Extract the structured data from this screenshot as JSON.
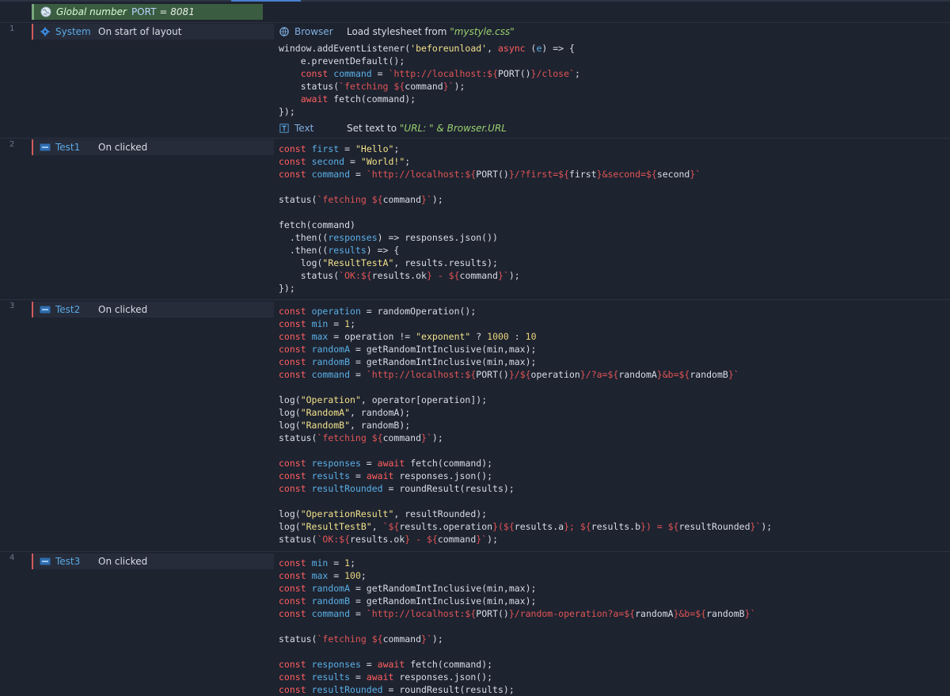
{
  "global": {
    "name": "Global number",
    "var": "PORT",
    "eq": "= 8081"
  },
  "events": [
    {
      "num": "1",
      "object": "System",
      "trigger": "On start of layout"
    },
    {
      "num": "2",
      "object": "Test1",
      "trigger": "On clicked"
    },
    {
      "num": "3",
      "object": "Test2",
      "trigger": "On clicked"
    },
    {
      "num": "4",
      "object": "Test3",
      "trigger": "On clicked"
    }
  ],
  "actions": {
    "browser": {
      "object": "Browser",
      "text": "Load stylesheet from ",
      "literal": "\"mystyle.css\""
    },
    "text": {
      "object": "Text",
      "text": "Set text to ",
      "literal": "\"URL: \" & Browser.URL"
    }
  },
  "colors": {
    "keyword": "#ff5f5f",
    "variable": "#5ab0e6",
    "string": "#f2e28a",
    "template": "#e05555",
    "background": "#1e2330"
  },
  "icons": {
    "global": "globe-icon",
    "system": "gear-icon",
    "button": "button-icon",
    "browser": "browser-icon",
    "text": "text-icon"
  }
}
